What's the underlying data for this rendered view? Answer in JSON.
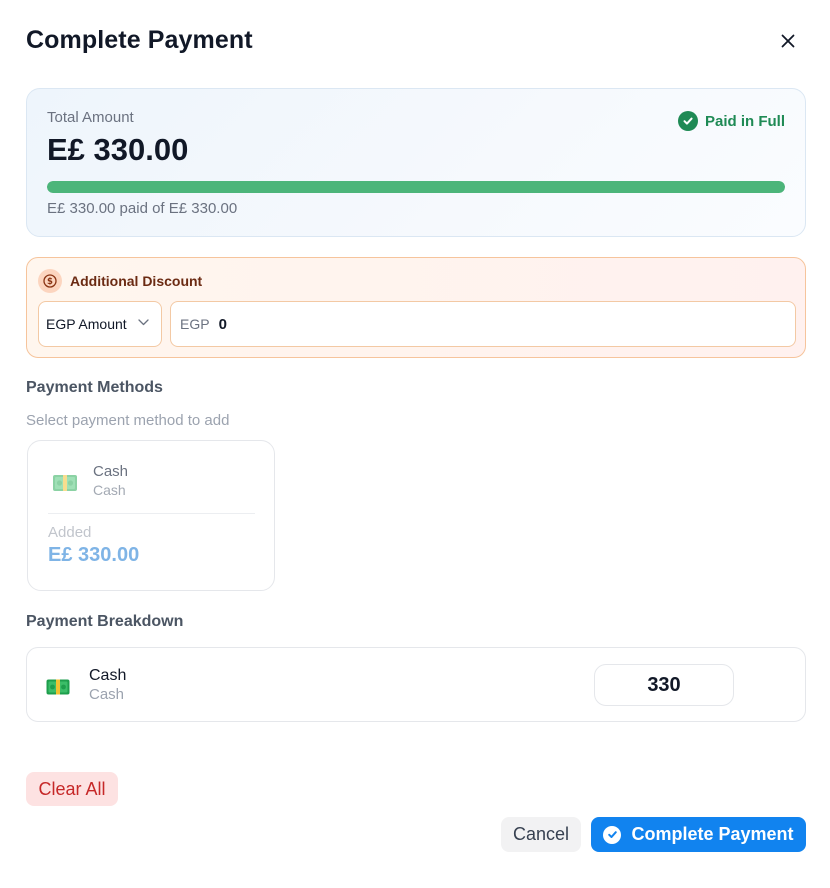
{
  "modal": {
    "title": "Complete Payment"
  },
  "summary": {
    "total_label": "Total Amount",
    "total_value": "E£ 330.00",
    "status": "Paid in Full",
    "status_color": "#1f8a55",
    "progress_fraction": 1.0,
    "progress_text": "E£ 330.00 paid of E£ 330.00"
  },
  "discount": {
    "title": "Additional Discount",
    "type_selected": "EGP Amount",
    "prefix": "EGP",
    "value": "0"
  },
  "payment_methods": {
    "title": "Payment Methods",
    "subtitle": "Select payment method to add",
    "items": [
      {
        "name": "Cash",
        "sub": "Cash",
        "added_label": "Added",
        "added_value": "E£ 330.00",
        "icon": "cash-icon"
      }
    ]
  },
  "breakdown": {
    "title": "Payment Breakdown",
    "items": [
      {
        "name": "Cash",
        "sub": "Cash",
        "amount": "330",
        "icon": "cash-icon"
      }
    ]
  },
  "actions": {
    "clear_all": "Clear All",
    "cancel": "Cancel",
    "complete": "Complete Payment"
  },
  "colors": {
    "accent": "#1183ef",
    "progress": "#4cb57a",
    "danger": "#c62828"
  }
}
